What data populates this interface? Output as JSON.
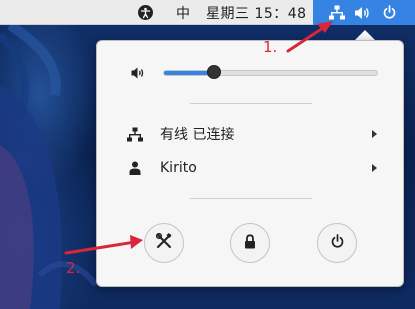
{
  "topbar": {
    "input_method": "中",
    "clock": "星期三 15：48",
    "icons": {
      "accessibility": "accessibility-icon",
      "network": "network-wired-icon",
      "volume": "volume-icon",
      "power": "power-icon"
    },
    "accent_color": "#3584e4"
  },
  "menu": {
    "volume": {
      "icon": "volume-low-icon",
      "level": 0.24
    },
    "items": [
      {
        "icon": "network-wired-icon",
        "label": "有线 已连接"
      },
      {
        "icon": "user-icon",
        "label": "Kirito"
      }
    ],
    "buttons": [
      {
        "icon": "settings-tools-icon",
        "name": "Settings"
      },
      {
        "icon": "lock-icon",
        "name": "Lock"
      },
      {
        "icon": "power-icon",
        "name": "Power Off"
      }
    ]
  },
  "annotations": {
    "label_1": "1.",
    "label_2": "2.",
    "color": "#d8263a"
  }
}
